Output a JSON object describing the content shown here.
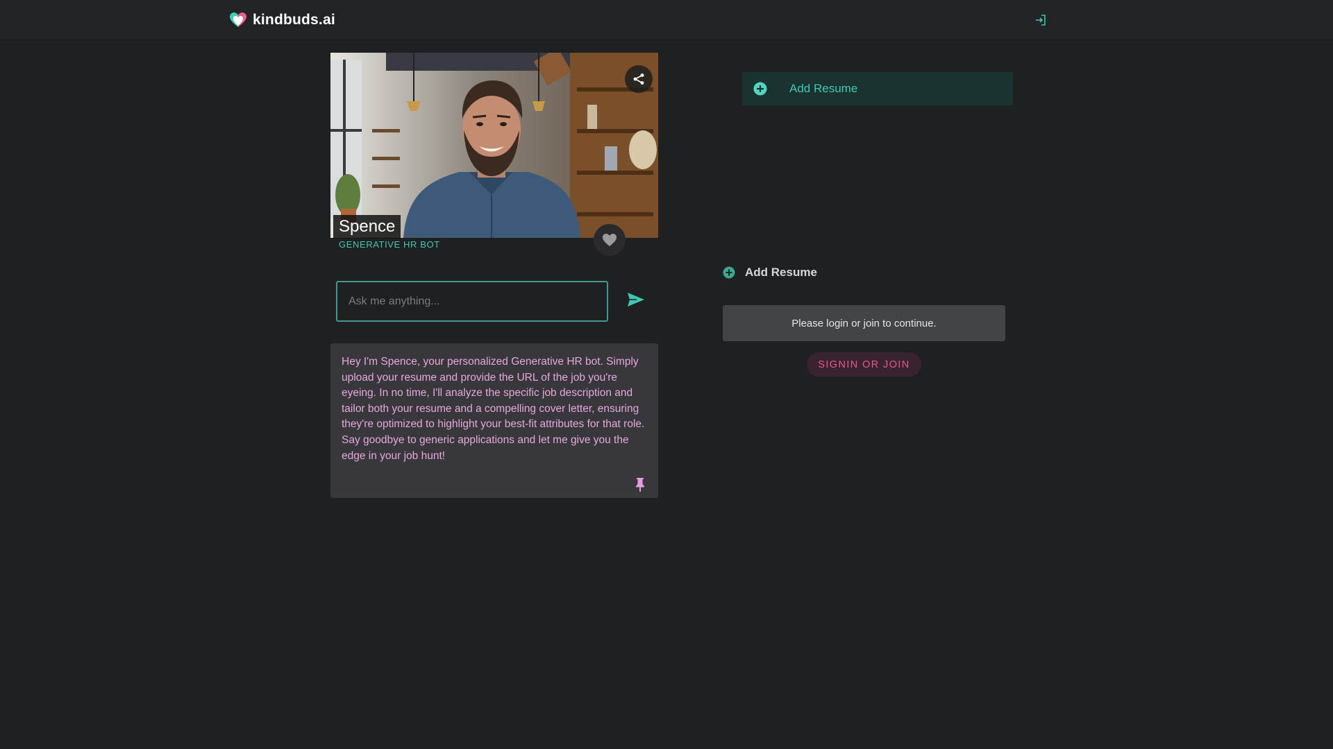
{
  "header": {
    "brand": "kindbuds.ai",
    "logo_icon": "heart-logo-icon",
    "login_icon": "login-icon"
  },
  "bot": {
    "name": "Spence",
    "role": "GENERATIVE HR BOT",
    "share_icon": "share-icon",
    "favorite_icon": "heart-icon"
  },
  "chat": {
    "placeholder": "Ask me anything...",
    "send_icon": "send-icon",
    "intro": "Hey I'm Spence, your personalized Generative HR bot. Simply upload your resume and provide the URL of the job you're eyeing. In no time, I'll analyze the specific job description and tailor both your resume and a compelling cover letter, ensuring they're optimized to highlight your best-fit attributes for that role. Say goodbye to generic applications and let me give you the edge in your job hunt!",
    "pin_icon": "pin-icon"
  },
  "panel": {
    "tab_label": "Add Resume",
    "heading": "Add Resume",
    "notice": "Please login or join to continue.",
    "signin_label": "SIGNIN OR JOIN"
  },
  "colors": {
    "background": "#1f2022",
    "accent_teal": "#43c7b3",
    "accent_pink": "#e8598f",
    "intro_text": "#e6a8df"
  }
}
